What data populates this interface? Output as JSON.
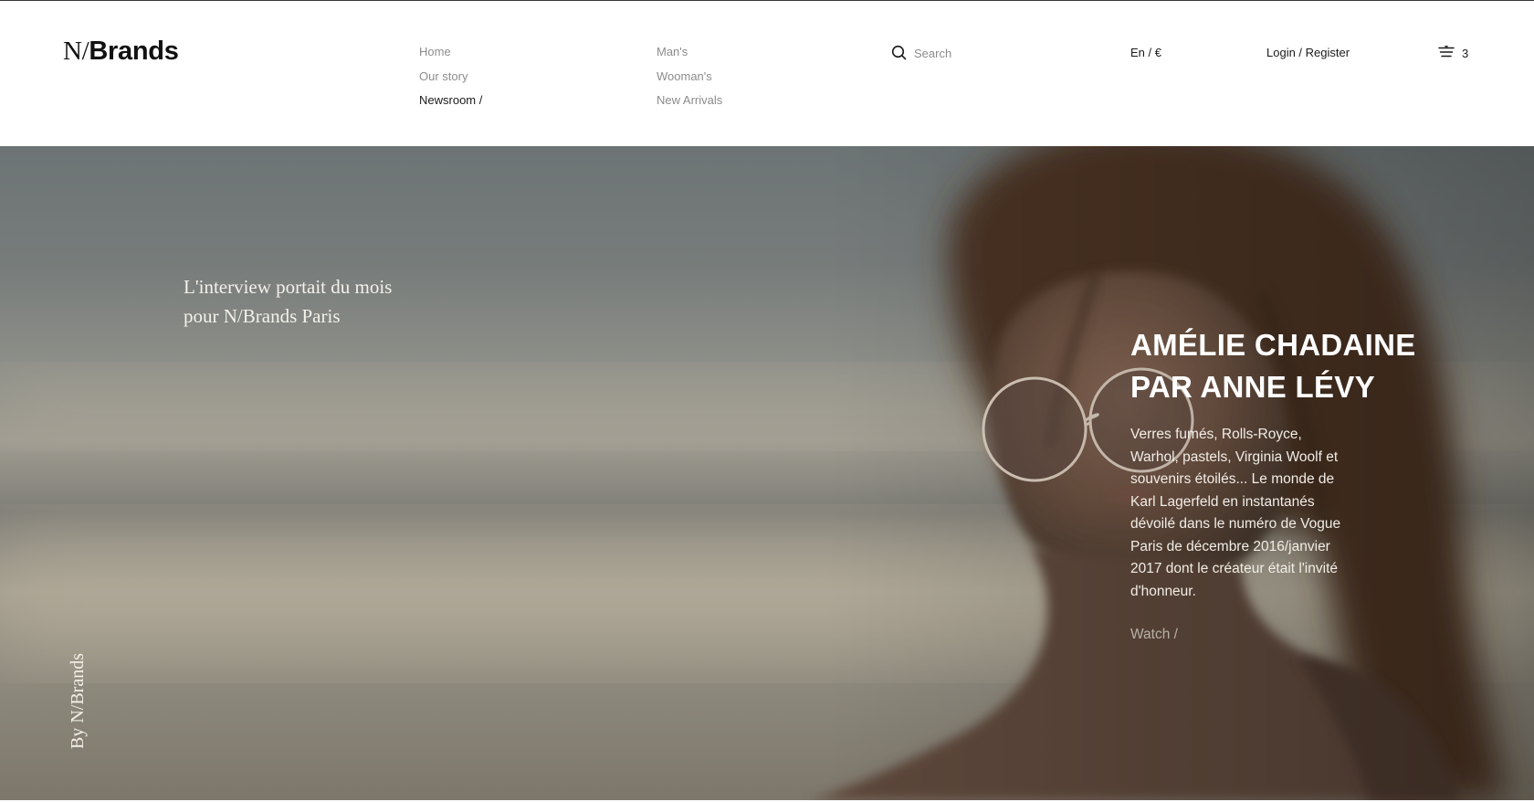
{
  "brand": {
    "logo_part1": "N/",
    "logo_part2": "Brands"
  },
  "nav": {
    "column1": [
      {
        "label": "Home",
        "active": false
      },
      {
        "label": "Our story",
        "active": false
      },
      {
        "label": "Newsroom /",
        "active": true
      }
    ],
    "column2": [
      {
        "label": "Man's"
      },
      {
        "label": "Wooman's"
      },
      {
        "label": "New Arrivals"
      }
    ]
  },
  "search": {
    "placeholder": "Search",
    "value": "",
    "icon": "search-icon"
  },
  "header": {
    "language_currency": "En / €",
    "login_label": "Login / Register",
    "cart_count": "3",
    "cart_icon": "cart-icon"
  },
  "hero": {
    "caption": "L'interview portait du mois pour N/Brands Paris",
    "byline": "By N/Brands",
    "title_line1": "AMÉLIE CHADAINE",
    "title_line2": "PAR ANNE LÉVY",
    "description": "Verres fumés, Rolls-Royce, Warhol, pastels, Virginia Woolf et souvenirs étoilés... Le monde de Karl Lagerfeld en instantanés dévoilé dans le numéro de Vogue Paris de décembre 2016/janvier 2017 dont le créateur était l'invité d'honneur.",
    "watch_label": "Watch /"
  },
  "colors": {
    "text_dark": "#1a1a1a",
    "nav_muted": "#8c8c8c",
    "hero_text": "#f4f1ea",
    "watch_link": "#b7b1a5"
  }
}
